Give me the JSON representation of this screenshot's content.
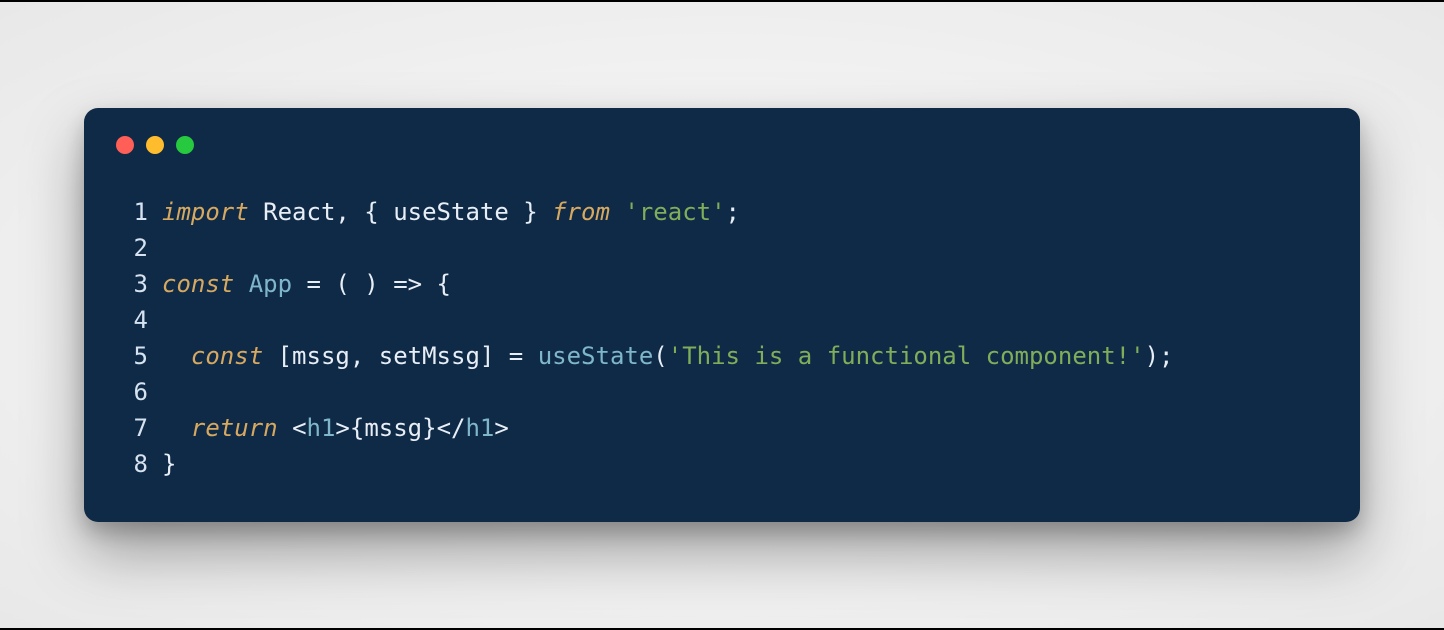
{
  "window": {
    "traffic_lights": {
      "red": "close",
      "yellow": "minimize",
      "green": "maximize"
    }
  },
  "code": {
    "lines": [
      {
        "num": "1",
        "tokens": [
          {
            "t": "import ",
            "c": "tok-keyword"
          },
          {
            "t": "React, { useState } ",
            "c": "tok-default"
          },
          {
            "t": "from ",
            "c": "tok-keyword"
          },
          {
            "t": "'react'",
            "c": "tok-string"
          },
          {
            "t": ";",
            "c": "tok-punct"
          }
        ]
      },
      {
        "num": "2",
        "tokens": []
      },
      {
        "num": "3",
        "tokens": [
          {
            "t": "const ",
            "c": "tok-keyword"
          },
          {
            "t": "App ",
            "c": "tok-type"
          },
          {
            "t": "= ( ) => {",
            "c": "tok-punct"
          }
        ]
      },
      {
        "num": "4",
        "tokens": []
      },
      {
        "num": "5",
        "tokens": [
          {
            "t": "  ",
            "c": "tok-default"
          },
          {
            "t": "const ",
            "c": "tok-keyword"
          },
          {
            "t": "[mssg, setMssg] ",
            "c": "tok-default"
          },
          {
            "t": "= ",
            "c": "tok-punct"
          },
          {
            "t": "useState",
            "c": "tok-func"
          },
          {
            "t": "(",
            "c": "tok-punct"
          },
          {
            "t": "'This is a functional component!'",
            "c": "tok-string"
          },
          {
            "t": ");",
            "c": "tok-punct"
          }
        ]
      },
      {
        "num": "6",
        "tokens": []
      },
      {
        "num": "7",
        "tokens": [
          {
            "t": "  ",
            "c": "tok-default"
          },
          {
            "t": "return ",
            "c": "tok-keyword"
          },
          {
            "t": "<",
            "c": "tok-punct"
          },
          {
            "t": "h1",
            "c": "tok-tag"
          },
          {
            "t": ">",
            "c": "tok-punct"
          },
          {
            "t": "{mssg}",
            "c": "tok-default"
          },
          {
            "t": "</",
            "c": "tok-punct"
          },
          {
            "t": "h1",
            "c": "tok-tag"
          },
          {
            "t": ">",
            "c": "tok-punct"
          }
        ]
      },
      {
        "num": "8",
        "tokens": [
          {
            "t": "}",
            "c": "tok-brace"
          }
        ]
      }
    ]
  }
}
